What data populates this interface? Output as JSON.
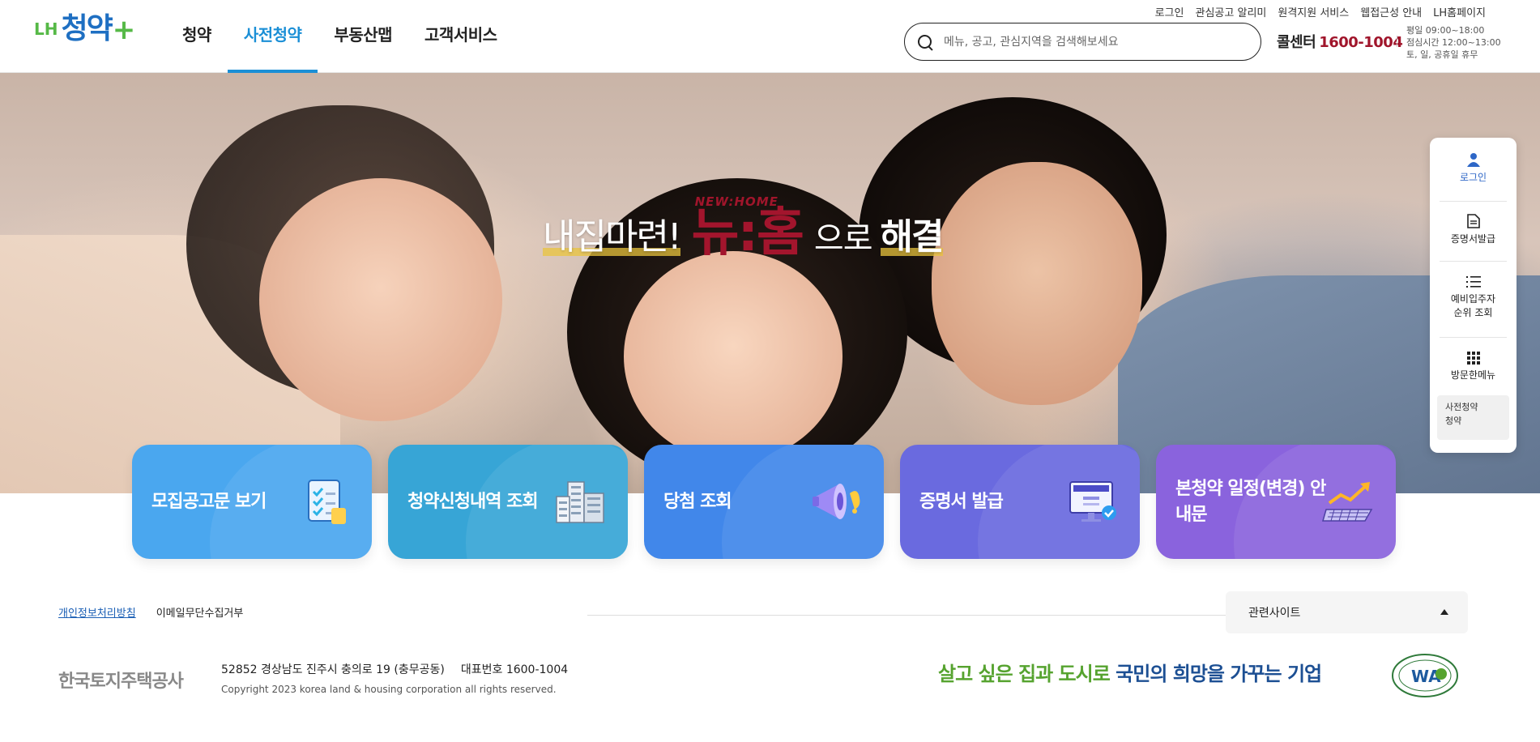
{
  "header": {
    "logo": {
      "prefix": "LH",
      "main": "청약",
      "plus": "+"
    },
    "nav": [
      "청약",
      "사전청약",
      "부동산맵",
      "고객서비스"
    ],
    "nav_active_index": 1,
    "util_links": [
      "로그인",
      "관심공고 알리미",
      "원격지원 서비스",
      "웹접근성 안내",
      "LH홈페이지"
    ],
    "search_placeholder": "메뉴, 공고, 관심지역을 검색해보세요",
    "call_label": "콜센터",
    "call_number": "1600-1004",
    "hours": [
      "평일 09:00~18:00",
      "점심시간 12:00~13:00",
      "토, 일, 공휴일 휴무"
    ]
  },
  "hero": {
    "headline_a": "내집마련!",
    "brand_sub": "NEW:HOME",
    "brand": "뉴:홈",
    "headline_c": "으로",
    "headline_d": "해결"
  },
  "cards": [
    {
      "label": "모집공고문 보기",
      "icon": "document-checklist-icon",
      "color": "#4aa7ef"
    },
    {
      "label": "청약신청내역 조회",
      "icon": "buildings-icon",
      "color": "#37a5d6"
    },
    {
      "label": "당첨 조회",
      "icon": "megaphone-icon",
      "color": "#4187ea"
    },
    {
      "label": "증명서 발급",
      "icon": "monitor-certificate-icon",
      "color": "#6a6adf"
    },
    {
      "label": "본청약 일정(변경) 안내문",
      "icon": "calendar-chart-icon",
      "color": "#8a63dd"
    }
  ],
  "quick_menu": {
    "items": [
      "로그인",
      "증명서발급",
      "예비입주자 순위 조회",
      "방문한메뉴"
    ],
    "recent": [
      "사전청약",
      "청약"
    ]
  },
  "footer": {
    "links": [
      "개인정보처리방침",
      "이메일무단수집거부"
    ],
    "related": "관련사이트",
    "corp": "한국토지주택공사",
    "address": "52852 경상남도 진주시 충의로 19 (충무공동)",
    "phone": "대표번호 1600-1004",
    "copyright": "Copyright 2023 korea land & housing corporation all rights reserved.",
    "slogan_a": "살고 싶은 집과 도시로",
    "slogan_b": "국민의 희망을 가꾸는 기업",
    "wa_label": "WA"
  }
}
